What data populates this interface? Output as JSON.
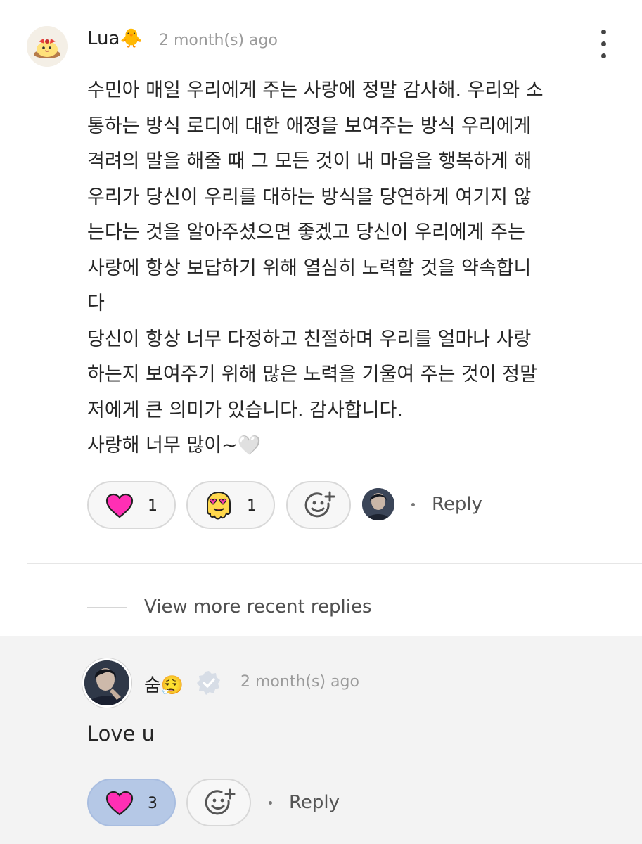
{
  "comment": {
    "username": "Lua🐥",
    "time": "2 month(s) ago",
    "more_icon": "kebab-menu-icon",
    "body": "수민아 매일 우리에게 주는 사랑에 정말 감사해. 우리와 소\n통하는 방식 로디에 대한 애정을 보여주는 방식 우리에게\n격려의 말을 해줄 때 그 모든 것이 내 마음을 행복하게 해\n우리가 당신이 우리를 대하는 방식을 당연하게 여기지 않\n는다는 것을 알아주셨으면 좋겠고 당신이 우리에게 주는\n사랑에 항상 보답하기 위해 열심히 노력할 것을 약속합니\n다\n당신이 항상 너무 다정하고 친절하며 우리를 얼마나 사랑\n하는지 보여주기 위해 많은 노력을 기울여 주는 것이 정말\n저에게 큰 의미가 있습니다. 감사합니다.\n사랑해 너무 많이~🤍",
    "reactions": [
      {
        "icon": "heart-icon",
        "count": "1",
        "color": "#ff2fb4"
      },
      {
        "icon": "heart-eyes-blob-icon",
        "count": "1",
        "color": "#ffd84d"
      }
    ],
    "add_reaction_icon": "add-reaction-icon",
    "reply_label": "Reply"
  },
  "view_more_replies": "View more recent replies",
  "reply": {
    "username": "숨😮‍💨",
    "verified_icon": "verified-badge-icon",
    "time": "2 month(s) ago",
    "body": "Love u",
    "reactions": [
      {
        "icon": "heart-icon",
        "count": "3",
        "color": "#ff2fb4",
        "active": true
      }
    ],
    "add_reaction_icon": "add-reaction-icon",
    "reply_label": "Reply"
  },
  "colors": {
    "accent_reaction_bg": "#b5c8e6",
    "reply_section_bg": "#f3f3f3"
  }
}
